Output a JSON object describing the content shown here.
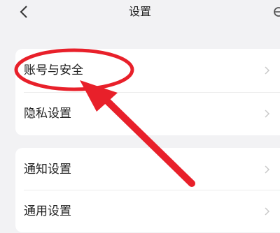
{
  "header": {
    "back_icon": "chevron-left-icon",
    "title": "设置",
    "right_icon": "settings-partial-icon"
  },
  "sections": [
    {
      "items": [
        {
          "label": "账号与安全",
          "chevron_icon": "chevron-right-icon"
        },
        {
          "label": "隐私设置",
          "chevron_icon": "chevron-right-icon"
        }
      ]
    },
    {
      "items": [
        {
          "label": "通知设置",
          "chevron_icon": "chevron-right-icon"
        },
        {
          "label": "通用设置",
          "chevron_icon": "chevron-right-icon"
        }
      ]
    }
  ],
  "annotation": {
    "color": "#e8202a",
    "highlight_target": "账号与安全"
  }
}
